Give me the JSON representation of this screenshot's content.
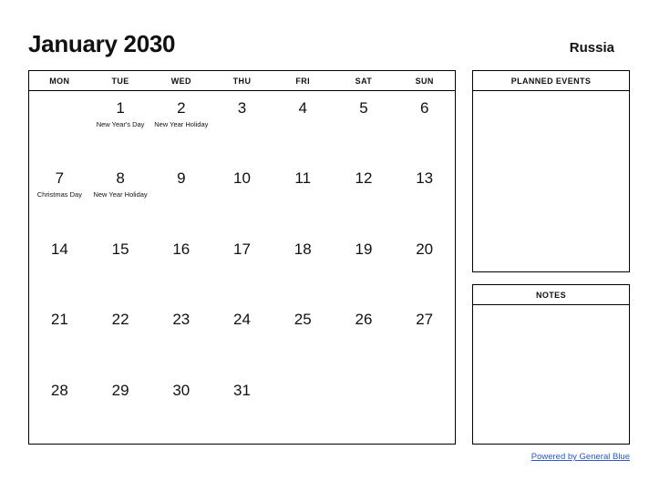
{
  "header": {
    "month_title": "January 2030",
    "country": "Russia"
  },
  "calendar": {
    "weekdays": [
      "MON",
      "TUE",
      "WED",
      "THU",
      "FRI",
      "SAT",
      "SUN"
    ],
    "weeks": [
      [
        {
          "day": "",
          "holiday": ""
        },
        {
          "day": "1",
          "holiday": "New Year's Day"
        },
        {
          "day": "2",
          "holiday": "New Year Holiday"
        },
        {
          "day": "3",
          "holiday": ""
        },
        {
          "day": "4",
          "holiday": ""
        },
        {
          "day": "5",
          "holiday": ""
        },
        {
          "day": "6",
          "holiday": ""
        }
      ],
      [
        {
          "day": "7",
          "holiday": "Christmas Day"
        },
        {
          "day": "8",
          "holiday": "New Year Holiday"
        },
        {
          "day": "9",
          "holiday": ""
        },
        {
          "day": "10",
          "holiday": ""
        },
        {
          "day": "11",
          "holiday": ""
        },
        {
          "day": "12",
          "holiday": ""
        },
        {
          "day": "13",
          "holiday": ""
        }
      ],
      [
        {
          "day": "14",
          "holiday": ""
        },
        {
          "day": "15",
          "holiday": ""
        },
        {
          "day": "16",
          "holiday": ""
        },
        {
          "day": "17",
          "holiday": ""
        },
        {
          "day": "18",
          "holiday": ""
        },
        {
          "day": "19",
          "holiday": ""
        },
        {
          "day": "20",
          "holiday": ""
        }
      ],
      [
        {
          "day": "21",
          "holiday": ""
        },
        {
          "day": "22",
          "holiday": ""
        },
        {
          "day": "23",
          "holiday": ""
        },
        {
          "day": "24",
          "holiday": ""
        },
        {
          "day": "25",
          "holiday": ""
        },
        {
          "day": "26",
          "holiday": ""
        },
        {
          "day": "27",
          "holiday": ""
        }
      ],
      [
        {
          "day": "28",
          "holiday": ""
        },
        {
          "day": "29",
          "holiday": ""
        },
        {
          "day": "30",
          "holiday": ""
        },
        {
          "day": "31",
          "holiday": ""
        },
        {
          "day": "",
          "holiday": ""
        },
        {
          "day": "",
          "holiday": ""
        },
        {
          "day": "",
          "holiday": ""
        }
      ]
    ]
  },
  "panels": {
    "planned_events": {
      "title": "PLANNED EVENTS",
      "content": ""
    },
    "notes": {
      "title": "NOTES",
      "content": ""
    }
  },
  "footer": {
    "link_label": "Powered by General Blue",
    "link_color": "#2a58c8"
  }
}
